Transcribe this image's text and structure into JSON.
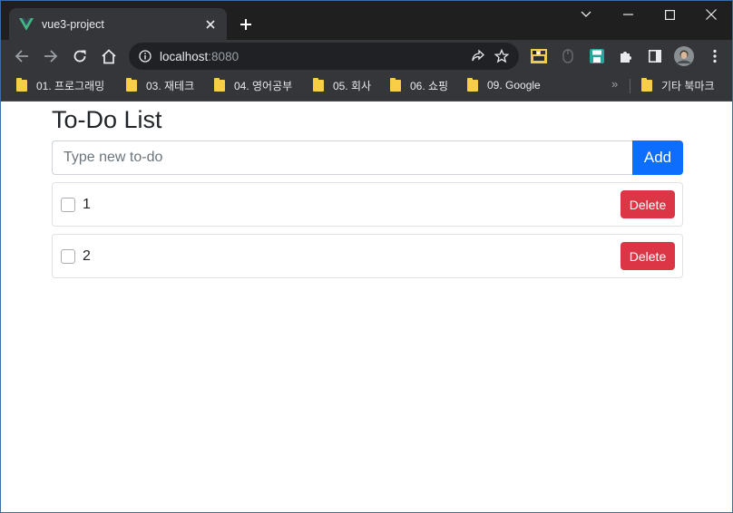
{
  "browser": {
    "tab": {
      "title": "vue3-project",
      "favicon": "vue-logo-icon"
    },
    "url": {
      "host": "localhost",
      "port": ":8080"
    },
    "bookmarks": [
      {
        "label": "01. 프로그래밍"
      },
      {
        "label": "03. 재테크"
      },
      {
        "label": "04. 영어공부"
      },
      {
        "label": "05. 회사"
      },
      {
        "label": "06. 쇼핑"
      },
      {
        "label": "09. Google"
      }
    ],
    "bookmarks_more": "»",
    "other_bookmarks": "기타 북마크"
  },
  "app": {
    "title": "To-Do List",
    "input": {
      "placeholder": "Type new to-do",
      "value": ""
    },
    "add_label": "Add",
    "todos": [
      {
        "text": "1",
        "done": false,
        "delete_label": "Delete"
      },
      {
        "text": "2",
        "done": false,
        "delete_label": "Delete"
      }
    ]
  },
  "colors": {
    "primary": "#0d6efd",
    "danger": "#dc3545",
    "vue_green": "#41b883",
    "folder_yellow": "#f7ce46"
  }
}
